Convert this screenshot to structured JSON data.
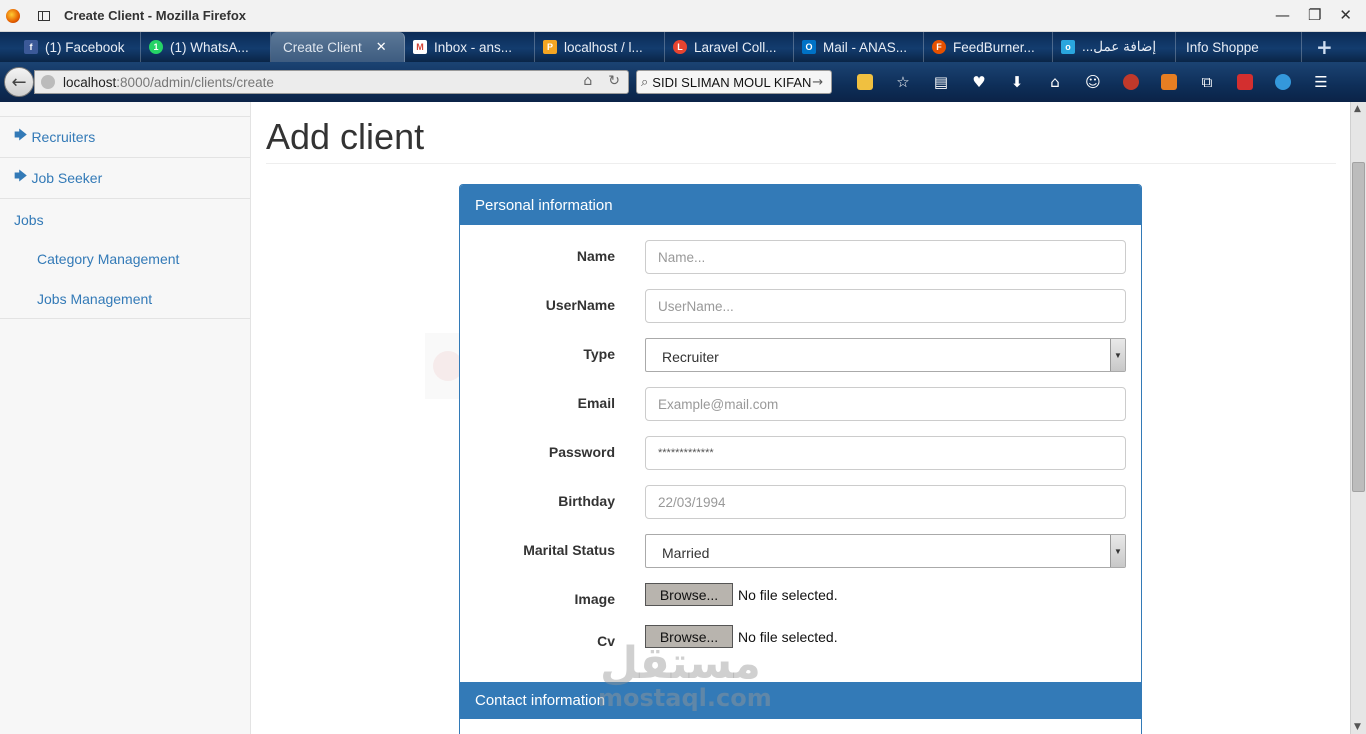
{
  "window": {
    "title": "Create Client - Mozilla Firefox",
    "controls": [
      "—",
      "❐",
      "✕"
    ]
  },
  "tabs": [
    {
      "label": "(1) Facebook",
      "icon": "facebook-icon",
      "color": "#3b5998",
      "glyph": "f"
    },
    {
      "label": "(1) WhatsA...",
      "icon": "whatsapp-icon",
      "color": "#25d366",
      "glyph": "1"
    },
    {
      "label": "Create Client",
      "icon": "",
      "color": "",
      "glyph": "",
      "active": true,
      "close": "✕"
    },
    {
      "label": "Inbox - ans...",
      "icon": "gmail-icon",
      "color": "#d44638",
      "glyph": "M"
    },
    {
      "label": "localhost / l...",
      "icon": "phpmyadmin-icon",
      "color": "#f5a623",
      "glyph": "P"
    },
    {
      "label": "Laravel Coll...",
      "icon": "laravel-icon",
      "color": "#e74430",
      "glyph": "L"
    },
    {
      "label": "Mail - ANAS...",
      "icon": "outlook-icon",
      "color": "#0072c6",
      "glyph": "O"
    },
    {
      "label": "FeedBurner...",
      "icon": "feedburner-icon",
      "color": "#e65100",
      "glyph": "F"
    },
    {
      "label": "...إضافة عمل",
      "icon": "mostaql-icon",
      "color": "#2aa6de",
      "glyph": "o"
    },
    {
      "label": "Info Shoppe",
      "icon": "",
      "color": "",
      "glyph": ""
    }
  ],
  "newtab": "+",
  "nav": {
    "url_host": "localhost",
    "url_path": ":8000/admin/clients/create",
    "search_value": "SIDI SLIMAN MOUL KIFAN"
  },
  "sidebar": {
    "items": [
      {
        "label": "Recruiters",
        "arrow": "🡆"
      },
      {
        "label": "Job Seeker",
        "arrow": "🡆"
      },
      {
        "label": "Jobs",
        "arrow": ""
      }
    ],
    "subitems": [
      "Category Management",
      "Jobs Management"
    ]
  },
  "main": {
    "title": "Add client",
    "panel_title": "Personal information",
    "panel2_title": "Contact information",
    "fields": {
      "name": {
        "label": "Name",
        "placeholder": "Name..."
      },
      "username": {
        "label": "UserName",
        "placeholder": "UserName..."
      },
      "type": {
        "label": "Type",
        "value": "Recruiter"
      },
      "email": {
        "label": "Email",
        "placeholder": "Example@mail.com"
      },
      "password": {
        "label": "Password",
        "value": "*************"
      },
      "birthday": {
        "label": "Birthday",
        "placeholder": "22/03/1994"
      },
      "marital": {
        "label": "Marital Status",
        "value": "Married"
      },
      "image": {
        "label": "Image",
        "button": "Browse...",
        "status": "No file selected."
      },
      "cv": {
        "label": "Cv",
        "button": "Browse...",
        "status": "No file selected."
      }
    }
  },
  "watermark": {
    "arabic": "مستقل",
    "latin": "mostaql.com"
  },
  "colors": {
    "primary": "#337ab7",
    "tabbar": "#133c6e"
  }
}
